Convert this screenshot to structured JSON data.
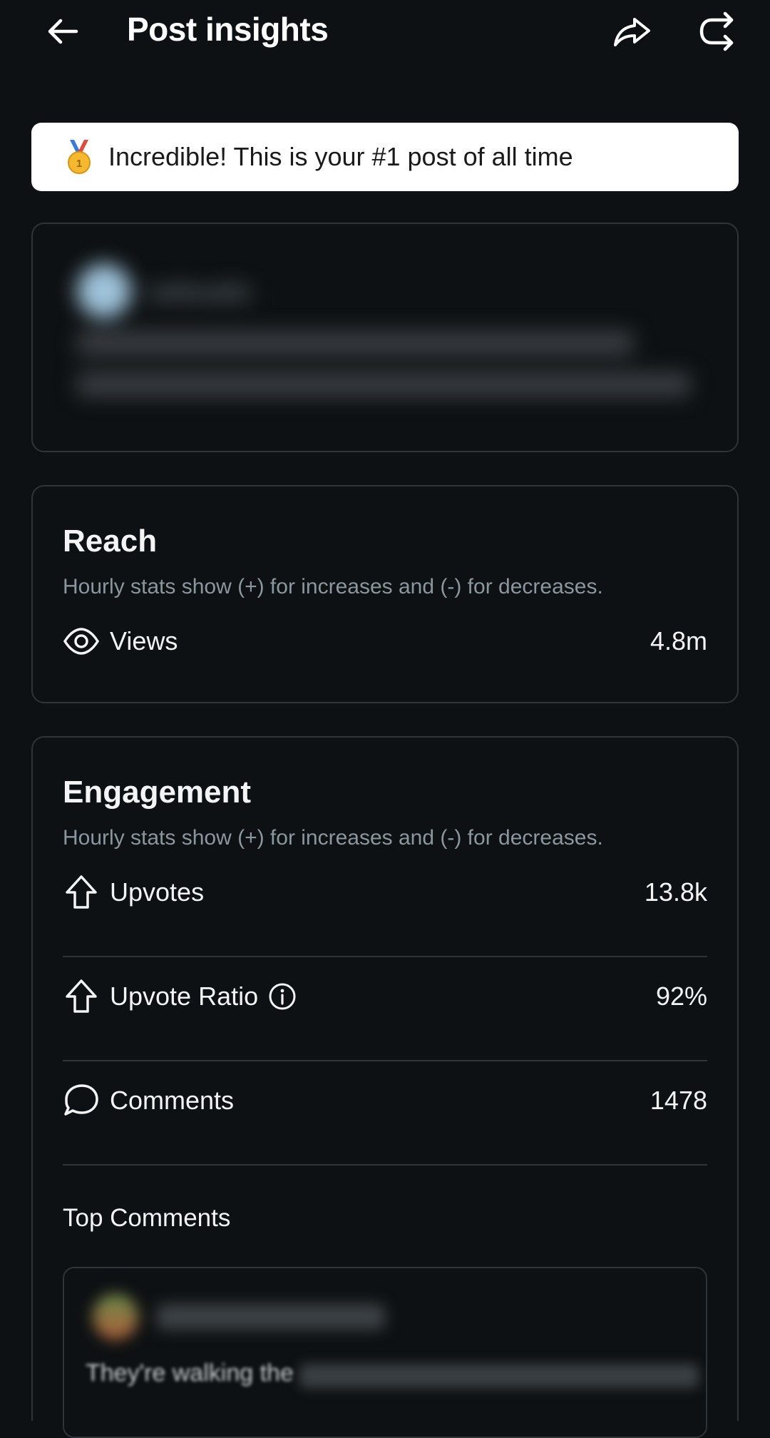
{
  "header": {
    "title": "Post insights"
  },
  "banner": {
    "text": "Incredible! This is your #1 post of all time"
  },
  "preview": {
    "author": "nkReddit"
  },
  "reach": {
    "title": "Reach",
    "subtitle": "Hourly stats show (+) for increases and (-) for decreases.",
    "rows": [
      {
        "label": "Views",
        "value": "4.8m"
      }
    ]
  },
  "engagement": {
    "title": "Engagement",
    "subtitle": "Hourly stats show (+) for increases and (-) for decreases.",
    "rows": [
      {
        "label": "Upvotes",
        "value": "13.8k"
      },
      {
        "label": "Upvote Ratio",
        "value": "92%"
      },
      {
        "label": "Comments",
        "value": "1478"
      }
    ],
    "top_comments_label": "Top Comments",
    "top_comment_snippet": "They're walking the"
  },
  "colors": {
    "background": "#0e1113",
    "card_border": "#2e3438",
    "banner_bg": "#ffffff",
    "muted_text": "#8b979e"
  }
}
